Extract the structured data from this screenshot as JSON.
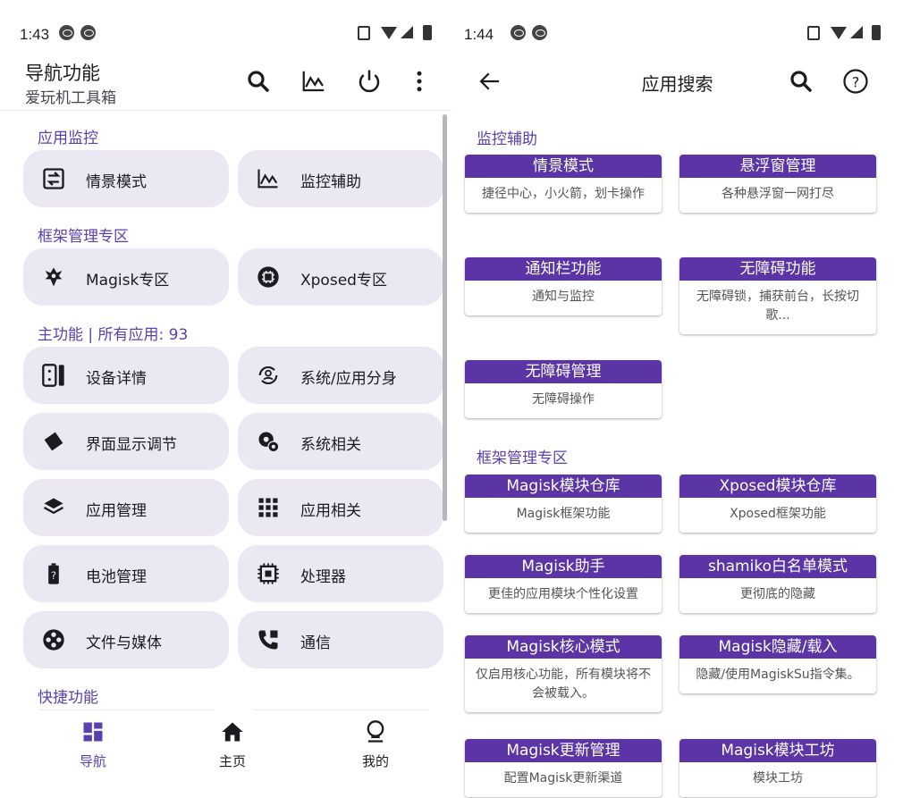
{
  "left": {
    "status": {
      "time": "1:43"
    },
    "appbar": {
      "title": "导航功能",
      "subtitle": "爱玩机工具箱"
    },
    "sections": {
      "monitor": "应用监控",
      "framework": "框架管理专区",
      "main": "主功能 | 所有应用: 93",
      "shortcut": "快捷功能"
    },
    "tiles": {
      "scene": "情景模式",
      "monitor_assist": "监控辅助",
      "magisk_zone": "Magisk专区",
      "xposed_zone": "Xposed专区",
      "device_info": "设备详情",
      "clone": "系统/应用分身",
      "display": "界面显示调节",
      "system": "系统相关",
      "app_manage": "应用管理",
      "app_related": "应用相关",
      "battery": "电池管理",
      "cpu": "处理器",
      "files": "文件与媒体",
      "comm": "通信"
    },
    "nav": {
      "nav": "导航",
      "home": "主页",
      "mine": "我的"
    }
  },
  "right": {
    "status": {
      "time": "1:44"
    },
    "appbar": {
      "title": "应用搜索"
    },
    "sections": {
      "assist": "监控辅助",
      "framework": "框架管理专区"
    },
    "cards": [
      {
        "title": "情景模式",
        "desc": "捷径中心，小火箭，划卡操作"
      },
      {
        "title": "悬浮窗管理",
        "desc": "各种悬浮窗一网打尽"
      },
      {
        "title": "通知栏功能",
        "desc": "通知与监控"
      },
      {
        "title": "无障碍功能",
        "desc": "无障碍锁，捕获前台，长按切歌..."
      },
      {
        "title": "无障碍管理",
        "desc": "无障碍操作"
      },
      {
        "title": "Magisk模块仓库",
        "desc": "Magisk框架功能"
      },
      {
        "title": "Xposed模块仓库",
        "desc": "Xposed框架功能"
      },
      {
        "title": "Magisk助手",
        "desc": "更佳的应用模块个性化设置"
      },
      {
        "title": "shamiko白名单模式",
        "desc": "更彻底的隐藏"
      },
      {
        "title": "Magisk核心模式",
        "desc": "仅启用核心功能，所有模块将不会被载入。"
      },
      {
        "title": "Magisk隐藏/载入",
        "desc": "隐藏/使用MagiskSu指令集。"
      },
      {
        "title": "Magisk更新管理",
        "desc": "配置Magisk更新渠道"
      },
      {
        "title": "Magisk模块工坊",
        "desc": "模块工坊"
      }
    ]
  },
  "colors": {
    "accent": "#5b40b0",
    "card_header": "#5b34a6",
    "tile_bg": "#ebe7f3"
  }
}
